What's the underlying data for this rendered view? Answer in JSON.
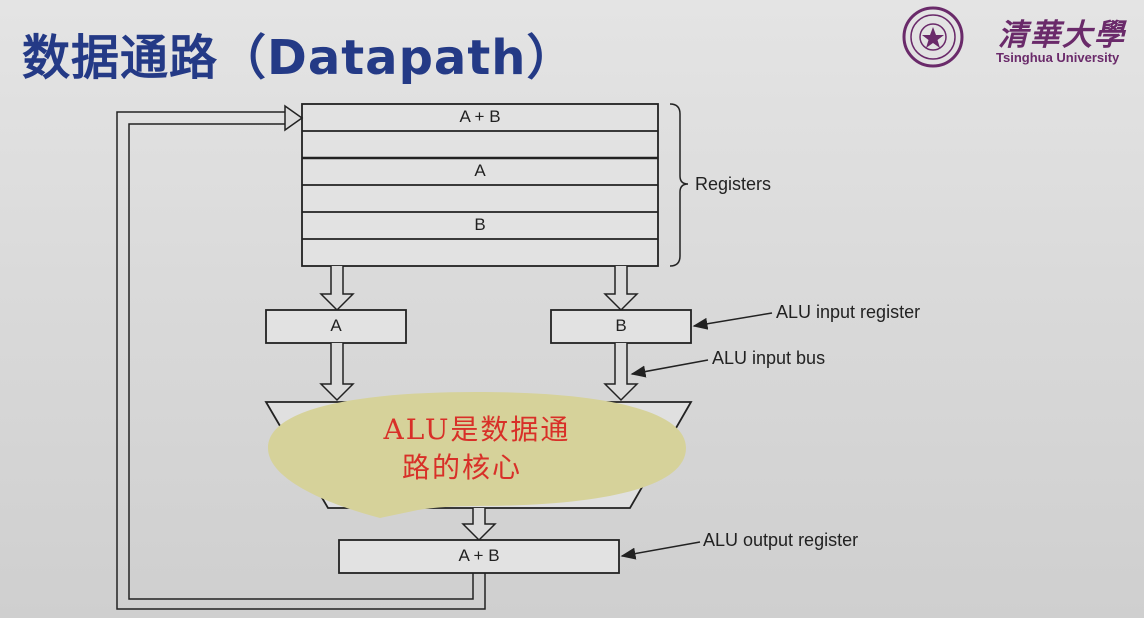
{
  "slide": {
    "title": "数据通路（Datapath）"
  },
  "logo": {
    "name_cn": "清華大學",
    "name_en": "Tsinghua University"
  },
  "diagram": {
    "registers": [
      "A + B",
      "",
      "A",
      "",
      "B",
      ""
    ],
    "registers_label": "Registers",
    "alu_input_left": "A",
    "alu_input_right": "B",
    "alu_output": "A + B",
    "annotations": {
      "alu_input_register": "ALU input register",
      "alu_input_bus": "ALU input bus",
      "alu_output_register": "ALU output register"
    },
    "callout": {
      "line1": "ALU是数据通",
      "line2": "路的核心"
    }
  },
  "colors": {
    "title": "#243a86",
    "university": "#6a2a6a",
    "callout_fill": "#d6d29a",
    "callout_text": "#d83028"
  }
}
